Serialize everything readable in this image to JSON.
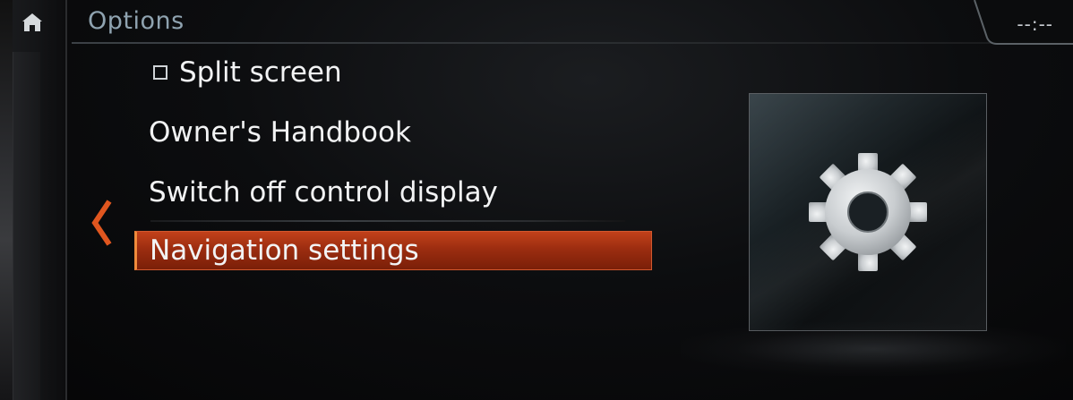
{
  "header": {
    "title": "Options",
    "clock": "--:--"
  },
  "menu": {
    "items": [
      {
        "label": "Split screen",
        "type": "checkbox",
        "checked": false
      },
      {
        "label": "Owner's Handbook",
        "type": "item"
      },
      {
        "label": "Switch off control display",
        "type": "item"
      },
      {
        "label": "Navigation settings",
        "type": "item",
        "selected": true
      }
    ]
  },
  "icons": {
    "home": "home-icon",
    "back": "chevron-left-icon",
    "preview": "gear-icon"
  },
  "colors": {
    "accent": "#c2411a",
    "chevron": "#e0561f",
    "title": "#8fa3b0"
  }
}
